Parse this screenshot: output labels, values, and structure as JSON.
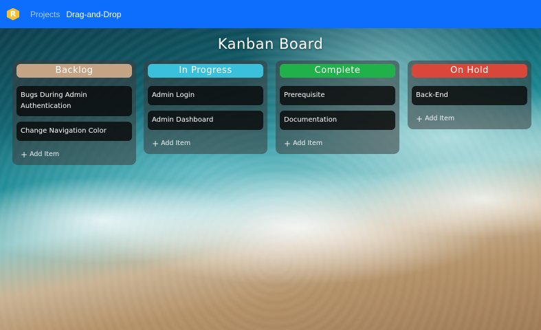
{
  "nav": {
    "logo_letter": "R",
    "breadcrumb": [
      "Projects",
      "Drag-and-Drop"
    ]
  },
  "board": {
    "title": "Kanban Board"
  },
  "columns": [
    {
      "name": "Backlog",
      "color": "#c4a484",
      "cards": [
        "Bugs During Admin Authentication",
        "Change Navigation Color"
      ],
      "add_label": "Add Item"
    },
    {
      "name": "In Progress",
      "color": "#3bc0dc",
      "cards": [
        "Admin Login",
        "Admin Dashboard"
      ],
      "add_label": "Add Item"
    },
    {
      "name": "Complete",
      "color": "#21b14a",
      "cards": [
        "Prerequisite",
        "Documentation"
      ],
      "add_label": "Add Item"
    },
    {
      "name": "On Hold",
      "color": "#d9463a",
      "cards": [
        "Back-End"
      ],
      "add_label": "Add Item"
    }
  ]
}
